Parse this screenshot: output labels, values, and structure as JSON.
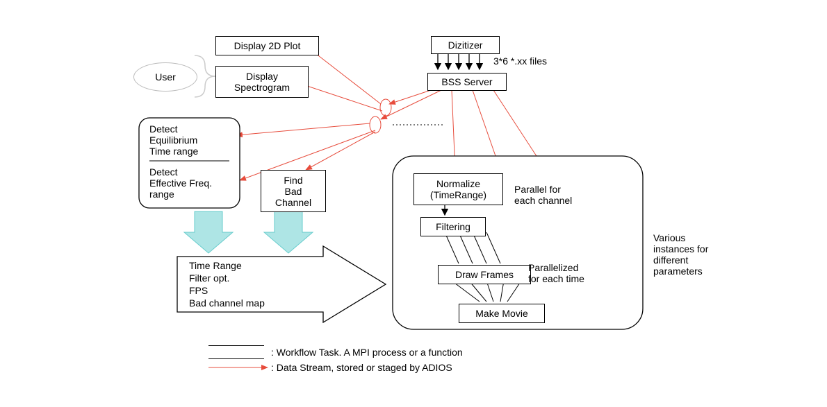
{
  "top": {
    "display2d": "Display 2D Plot",
    "displaySpectrogram": "Display\nSpectrogram",
    "user": "User",
    "dizitizer": "Dizitizer",
    "filesNote": "3*6 *.xx files",
    "bssServer": "BSS Server"
  },
  "detect": {
    "detectEquilibrium": "Detect\nEquilibrium\nTime range",
    "detectEffective": "Detect\nEffective Freq.\nrange",
    "findBadChannel": "Find\nBad\nChannel"
  },
  "params": {
    "timeRange": "Time Range",
    "filterOpt": "Filter opt.",
    "fps": "FPS",
    "badChannelMap": "Bad channel map"
  },
  "pipeline": {
    "normalize": "Normalize\n(TimeRange)",
    "filtering": "Filtering",
    "parallelChannel": "Parallel for\neach channel",
    "drawFrames": "Draw Frames",
    "parallelTime": "Parallelized\nfor each time",
    "makeMovie": "Make Movie"
  },
  "sideNote": "Various\ninstances for\ndifferent\nparameters",
  "legend": {
    "task": ": Workflow Task. A MPI process or a function",
    "stream": ": Data Stream, stored or staged by ADIOS"
  }
}
